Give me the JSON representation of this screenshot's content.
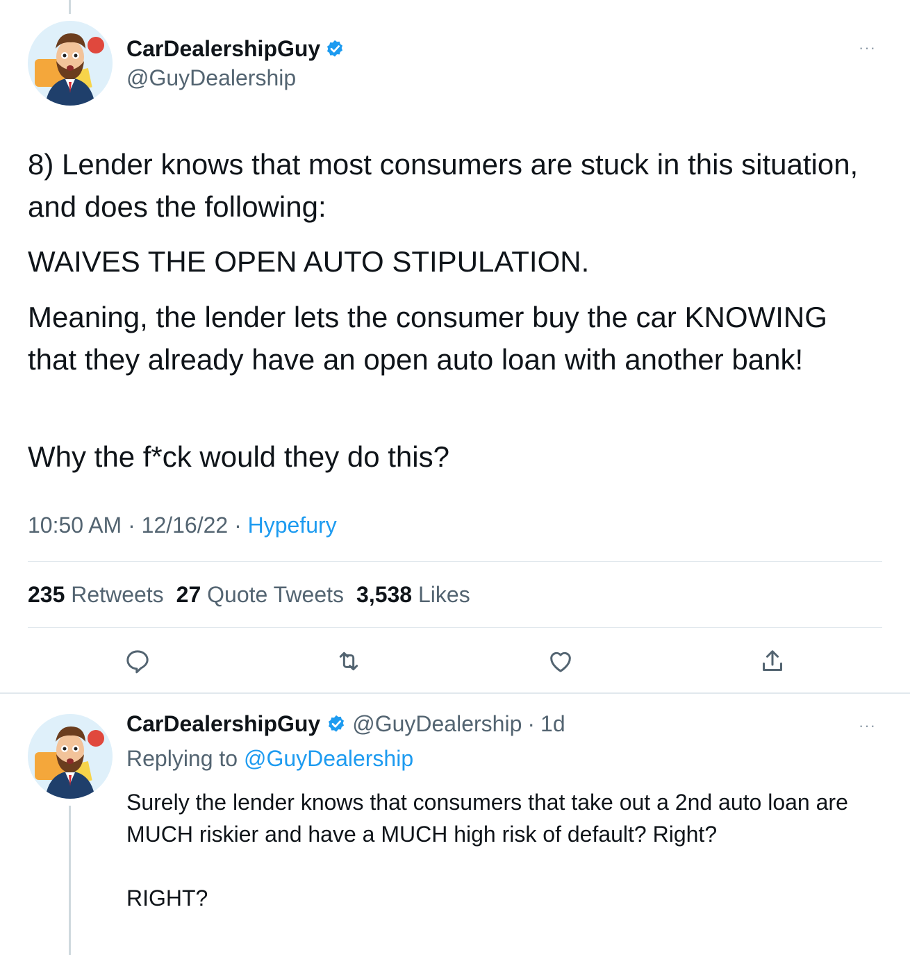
{
  "main_tweet": {
    "author_name": "CarDealershipGuy",
    "handle": "@GuyDealership",
    "paragraphs": [
      "8) Lender knows that most consumers are stuck in this situation, and does the following:",
      "WAIVES THE OPEN AUTO STIPULATION.",
      "Meaning, the lender lets the consumer buy the car KNOWING that they already have an open auto loan with another bank!",
      "Why the f*ck would they do this?"
    ],
    "time": "10:50 AM",
    "date": "12/16/22",
    "source": "Hypefury",
    "stats": {
      "retweets_count": "235",
      "retweets_label": "Retweets",
      "quotes_count": "27",
      "quotes_label": "Quote Tweets",
      "likes_count": "3,538",
      "likes_label": "Likes"
    },
    "more_glyph": "···"
  },
  "reply_tweet": {
    "author_name": "CarDealershipGuy",
    "handle": "@GuyDealership",
    "age": "1d",
    "replying_label": "Replying to",
    "replying_to": "@GuyDealership",
    "paragraphs": [
      "Surely the lender knows that consumers that take out a 2nd auto loan are MUCH riskier and have a MUCH high risk of default? Right?",
      "RIGHT?"
    ],
    "more_glyph": "···"
  },
  "icons": [
    "reply-icon",
    "retweet-icon",
    "like-icon",
    "share-icon",
    "verified-badge-icon"
  ],
  "colors": {
    "link": "#1d9bf0",
    "secondary_text": "#536471",
    "divider": "#e1e8ed"
  }
}
